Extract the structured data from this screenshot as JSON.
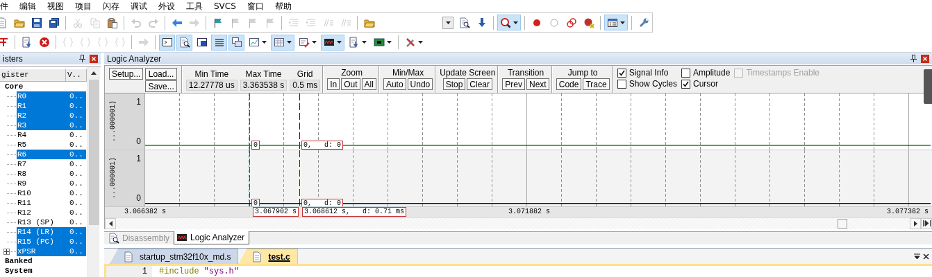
{
  "menu": [
    "件",
    "编辑",
    "视图",
    "项目",
    "闪存",
    "调试",
    "外设",
    "工具",
    "SVCS",
    "窗口",
    "帮助"
  ],
  "toolbar_1": [
    {
      "kind": "button",
      "pressed": false,
      "disabled": false
    },
    {
      "kind": "button",
      "pressed": false,
      "disabled": false
    },
    {
      "kind": "button",
      "pressed": false,
      "disabled": false
    },
    {
      "kind": "button",
      "pressed": false,
      "disabled": false
    },
    {
      "kind": "separator"
    },
    {
      "kind": "button",
      "pressed": false,
      "disabled": true
    },
    {
      "kind": "button",
      "pressed": false,
      "disabled": true
    },
    {
      "kind": "button",
      "pressed": false,
      "disabled": false
    },
    {
      "kind": "separator"
    },
    {
      "kind": "button",
      "pressed": false,
      "disabled": true
    },
    {
      "kind": "button",
      "pressed": false,
      "disabled": true
    },
    {
      "kind": "separator"
    },
    {
      "kind": "button",
      "pressed": false,
      "disabled": false
    },
    {
      "kind": "button",
      "pressed": false,
      "disabled": true
    },
    {
      "kind": "separator"
    },
    {
      "kind": "button",
      "pressed": false,
      "disabled": false
    },
    {
      "kind": "button",
      "pressed": false,
      "disabled": true
    },
    {
      "kind": "button",
      "pressed": false,
      "disabled": true
    },
    {
      "kind": "button",
      "pressed": false,
      "disabled": true
    },
    {
      "kind": "separator"
    },
    {
      "kind": "button",
      "pressed": false,
      "disabled": true
    },
    {
      "kind": "button",
      "pressed": false,
      "disabled": true
    },
    {
      "kind": "button",
      "pressed": false,
      "disabled": true
    },
    {
      "kind": "button",
      "pressed": false,
      "disabled": true
    },
    {
      "kind": "separator"
    },
    {
      "kind": "button",
      "pressed": false,
      "disabled": false
    },
    {
      "kind": "combo"
    },
    {
      "kind": "button",
      "pressed": false,
      "disabled": false
    },
    {
      "kind": "button",
      "pressed": false,
      "disabled": false
    },
    {
      "kind": "separator"
    },
    {
      "kind": "dropdown",
      "pressed": true,
      "disabled": false
    },
    {
      "kind": "separator"
    },
    {
      "kind": "button",
      "pressed": false,
      "disabled": false
    },
    {
      "kind": "button",
      "pressed": false,
      "disabled": false
    },
    {
      "kind": "button",
      "pressed": false,
      "disabled": false
    },
    {
      "kind": "button",
      "pressed": false,
      "disabled": false
    },
    {
      "kind": "separator"
    },
    {
      "kind": "dropdown",
      "pressed": true,
      "disabled": false
    },
    {
      "kind": "separator"
    },
    {
      "kind": "button",
      "pressed": false,
      "disabled": false
    }
  ],
  "toolbar_2": [
    {
      "kind": "button",
      "pressed": false,
      "disabled": false
    },
    {
      "kind": "separator"
    },
    {
      "kind": "button",
      "pressed": false,
      "disabled": false
    },
    {
      "kind": "button",
      "pressed": false,
      "disabled": false
    },
    {
      "kind": "separator"
    },
    {
      "kind": "button",
      "pressed": false,
      "disabled": true
    },
    {
      "kind": "button",
      "pressed": false,
      "disabled": true
    },
    {
      "kind": "button",
      "pressed": false,
      "disabled": true
    },
    {
      "kind": "button",
      "pressed": false,
      "disabled": true
    },
    {
      "kind": "separator"
    },
    {
      "kind": "button",
      "pressed": false,
      "disabled": true
    },
    {
      "kind": "separator"
    },
    {
      "kind": "button",
      "pressed": true,
      "disabled": false
    },
    {
      "kind": "button",
      "pressed": true,
      "disabled": false
    },
    {
      "kind": "button",
      "pressed": false,
      "disabled": false
    },
    {
      "kind": "button",
      "pressed": true,
      "disabled": false
    },
    {
      "kind": "button",
      "pressed": true,
      "disabled": false
    },
    {
      "kind": "dropdown",
      "pressed": false,
      "disabled": false
    },
    {
      "kind": "dropdown",
      "pressed": true,
      "disabled": false
    },
    {
      "kind": "dropdown",
      "pressed": false,
      "disabled": false
    },
    {
      "kind": "dropdown",
      "pressed": true,
      "disabled": false
    },
    {
      "kind": "dropdown",
      "pressed": false,
      "disabled": false
    },
    {
      "kind": "dropdown",
      "pressed": false,
      "disabled": false
    },
    {
      "kind": "separator"
    },
    {
      "kind": "dropdown",
      "pressed": false,
      "disabled": false
    }
  ],
  "registers": {
    "title": "isters",
    "columns": [
      "gister",
      "V.."
    ],
    "tree": [
      {
        "name": "Core",
        "children": [
          {
            "name": "R0",
            "value": "0..",
            "selected": true,
            "kind": "register"
          },
          {
            "name": "R1",
            "value": "0..",
            "selected": true,
            "kind": "register"
          },
          {
            "name": "R2",
            "value": "0..",
            "selected": true,
            "kind": "register"
          },
          {
            "name": "R3",
            "value": "0..",
            "selected": true,
            "kind": "register"
          },
          {
            "name": "R4",
            "value": "0..",
            "selected": false,
            "kind": "register"
          },
          {
            "name": "R5",
            "value": "0..",
            "selected": false,
            "kind": "register"
          },
          {
            "name": "R6",
            "value": "0..",
            "selected": true,
            "kind": "register"
          },
          {
            "name": "R7",
            "value": "0..",
            "selected": false,
            "kind": "register"
          },
          {
            "name": "R8",
            "value": "0..",
            "selected": false,
            "kind": "register"
          },
          {
            "name": "R9",
            "value": "0..",
            "selected": false,
            "kind": "register"
          },
          {
            "name": "R10",
            "value": "0..",
            "selected": false,
            "kind": "register"
          },
          {
            "name": "R11",
            "value": "0..",
            "selected": false,
            "kind": "register"
          },
          {
            "name": "R12",
            "value": "0..",
            "selected": false,
            "kind": "register"
          },
          {
            "name": "R13 (SP)",
            "value": "0..",
            "selected": false,
            "kind": "register"
          },
          {
            "name": "R14 (LR)",
            "value": "0..",
            "selected": true,
            "kind": "register"
          },
          {
            "name": "R15 (PC)",
            "value": "0..",
            "selected": true,
            "kind": "register"
          },
          {
            "name": "xPSR",
            "value": "0..",
            "selected": true,
            "kind": "group"
          }
        ]
      },
      {
        "name": "Banked"
      },
      {
        "name": "System"
      }
    ]
  },
  "logic_analyzer": {
    "title": "Logic Analyzer",
    "setup": "Setup...",
    "load": "Load...",
    "save": "Save...",
    "fields": [
      {
        "heading": "Min Time",
        "value": "12.27778 us"
      },
      {
        "heading": "Max Time",
        "value": "3.363538 s"
      },
      {
        "heading": "Grid",
        "value": "0.5 ms"
      }
    ],
    "button_groups": [
      {
        "heading": "Zoom",
        "buttons": [
          "In",
          "Out",
          "All"
        ]
      },
      {
        "heading": "Min/Max",
        "buttons": [
          "Auto",
          "Undo"
        ]
      },
      {
        "heading": "Update Screen",
        "buttons": [
          "Stop",
          "Clear"
        ]
      },
      {
        "heading": "Transition",
        "buttons": [
          "Prev",
          "Next"
        ]
      },
      {
        "heading": "Jump to",
        "buttons": [
          "Code",
          "Trace"
        ]
      }
    ],
    "options": [
      {
        "label": "Signal Info",
        "checked": true,
        "disabled": false
      },
      {
        "label": "Amplitude",
        "checked": false,
        "disabled": false
      },
      {
        "label": "Timestamps Enable",
        "checked": false,
        "disabled": true
      },
      {
        "label": "Show Cycles",
        "checked": false,
        "disabled": false
      },
      {
        "label": "Cursor",
        "checked": true,
        "disabled": false
      }
    ],
    "signals": [
      {
        "label": "...000001)",
        "high": "1",
        "low": "0",
        "color": "#008000",
        "selected": true,
        "cursor_value": "0",
        "marker_value": "0,   d: 0"
      },
      {
        "label": "...000001)",
        "high": "1",
        "low": "0",
        "color": "#000080",
        "selected": false,
        "cursor_value": "0",
        "marker_value": "0,   d: 0"
      }
    ],
    "time_axis": [
      {
        "kind": "plain",
        "text": "3.066382 s"
      },
      {
        "kind": "cursor",
        "text": "3.067902 s"
      },
      {
        "kind": "cursor",
        "text": "3.068612 s,   d: 0.71 ms"
      },
      {
        "kind": "plain",
        "text": "3.071882 s"
      },
      {
        "kind": "plain",
        "text": "3.077382 s"
      }
    ]
  },
  "view_tabs": [
    {
      "label": "Disassembly",
      "selected": false
    },
    {
      "label": "Logic Analyzer",
      "selected": true
    }
  ],
  "editor_tabs": [
    {
      "label": "startup_stm32f10x_md.s",
      "selected": false
    },
    {
      "label": "test.c",
      "selected": true
    }
  ],
  "code_lines": [
    {
      "number": "1",
      "tokens": [
        {
          "kind": "directive",
          "text": "#include"
        },
        {
          "kind": "string",
          "text": "\"sys.h\""
        }
      ]
    }
  ]
}
